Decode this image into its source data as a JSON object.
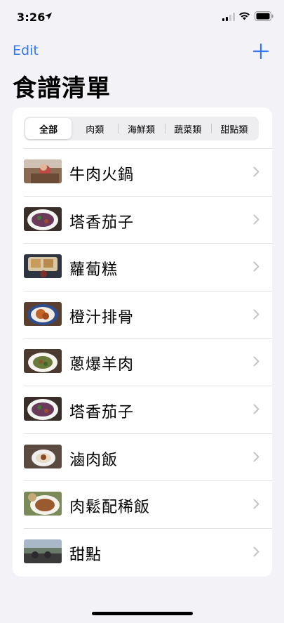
{
  "status_bar": {
    "time": "3:26"
  },
  "nav": {
    "edit_label": "Edit",
    "add_icon": "plus-icon"
  },
  "page_title": "食譜清單",
  "segments": [
    {
      "label": "全部",
      "selected": true
    },
    {
      "label": "肉類",
      "selected": false
    },
    {
      "label": "海鮮類",
      "selected": false
    },
    {
      "label": "蔬菜類",
      "selected": false
    },
    {
      "label": "甜點類",
      "selected": false
    }
  ],
  "recipes": [
    {
      "name": "牛肉火鍋"
    },
    {
      "name": "塔香茄子"
    },
    {
      "name": "蘿蔔糕"
    },
    {
      "name": "橙汁排骨"
    },
    {
      "name": "蔥爆羊肉"
    },
    {
      "name": "塔香茄子"
    },
    {
      "name": "滷肉飯"
    },
    {
      "name": "肉鬆配稀飯"
    },
    {
      "name": "甜點"
    }
  ],
  "colors": {
    "accent": "#3478f6",
    "background": "#f2f2f7",
    "chevron": "#c4c4c7"
  }
}
